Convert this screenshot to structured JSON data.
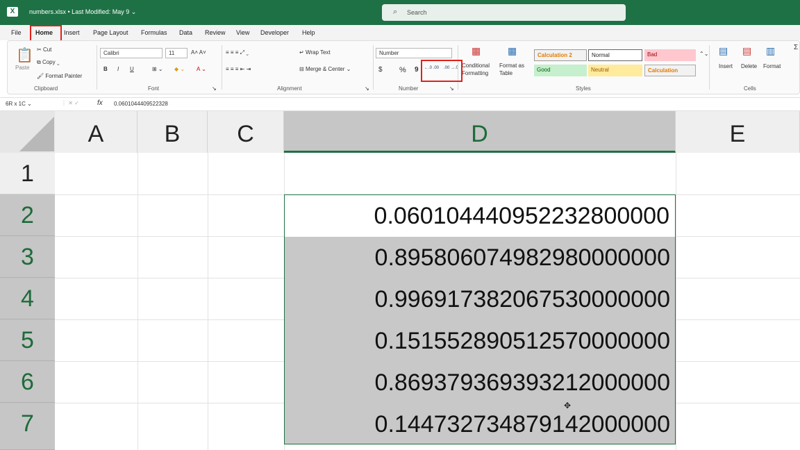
{
  "titlebar": {
    "filename": "numbers.xlsx",
    "modified": "• Last Modified: May 9 ⌄",
    "search_placeholder": "Search"
  },
  "menu": [
    "File",
    "Home",
    "Insert",
    "Page Layout",
    "Formulas",
    "Data",
    "Review",
    "View",
    "Developer",
    "Help"
  ],
  "ribbon": {
    "clipboard": {
      "paste": "Paste",
      "cut": "Cut",
      "copy": "Copy",
      "format_painter": "Format Painter",
      "label": "Clipboard"
    },
    "font": {
      "name": "Calibri",
      "size": "11",
      "label": "Font",
      "bold": "B",
      "italic": "I",
      "underline": "U"
    },
    "alignment": {
      "wrap": "Wrap Text",
      "merge": "Merge & Center",
      "label": "Alignment"
    },
    "number": {
      "format": "Number",
      "currency": "$",
      "percent": "%",
      "comma": "9",
      "inc_decimal": "←.0 .00",
      "dec_decimal": ".00 →.0",
      "label": "Number"
    },
    "styles": {
      "conditional": "Conditional Formatting",
      "format_table": "Format as Table",
      "label": "Styles",
      "cells": [
        "Calculation 2",
        "Normal",
        "Bad",
        "Good",
        "Neutral",
        "Calculation"
      ]
    },
    "cells": {
      "insert": "Insert",
      "delete": "Delete",
      "format": "Format",
      "label": "Cells"
    }
  },
  "formula_bar": {
    "name_box": "6R x 1C",
    "fx": "fx",
    "value": "0.0601044409522328"
  },
  "columns": [
    "A",
    "B",
    "C",
    "D",
    "E"
  ],
  "rows": [
    "1",
    "2",
    "3",
    "4",
    "5",
    "6",
    "7"
  ],
  "cells_d": [
    "0.060104440952232800000",
    "0.895806074982980000000",
    "0.996917382067530000000",
    "0.151552890512570000000",
    "0.869379369393212000000",
    "0.144732734879142000000"
  ],
  "colors": {
    "excel_green": "#1e7145",
    "highlight_red": "#e0201b"
  }
}
